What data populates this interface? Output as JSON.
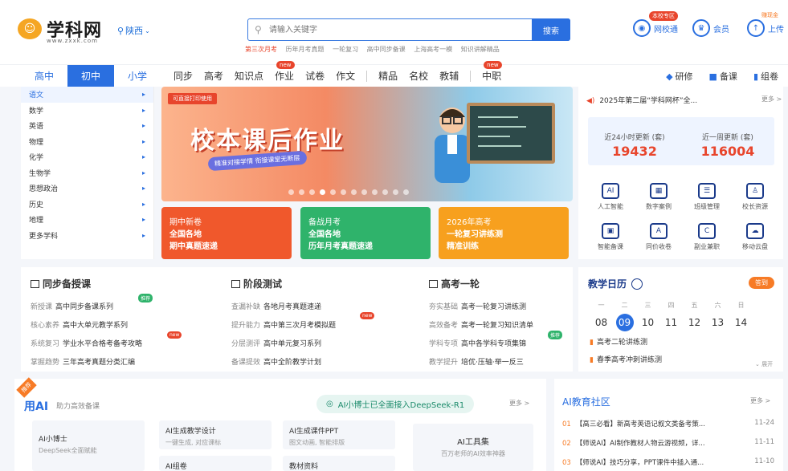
{
  "header": {
    "logo_text": "学科网",
    "logo_sub": "www.zxxk.com",
    "region": "陕西",
    "search_placeholder": "请输入关键字",
    "search_button": "搜索",
    "hotwords": [
      "第三次月考",
      "历年月考真题",
      "一轮复习",
      "高中同步备课",
      "上海高考一模",
      "知识讲解精品"
    ],
    "tools": [
      {
        "label": "网校通",
        "badge": "本校专区",
        "icon": "school-icon"
      },
      {
        "label": "会员",
        "badge": "",
        "icon": "vip-icon"
      },
      {
        "label": "上传",
        "badge": "赚现金",
        "icon": "upload-icon"
      }
    ]
  },
  "nav": {
    "stages": [
      "高中",
      "初中",
      "小学"
    ],
    "items": [
      "同步",
      "高考",
      "知识点",
      "作业",
      "试卷",
      "作文"
    ],
    "items2": [
      "精品",
      "名校",
      "教辅"
    ],
    "items3": [
      "中职"
    ],
    "new_label": "new",
    "right_links": [
      {
        "icon": "mortarboard-icon",
        "label": "研修"
      },
      {
        "icon": "book-icon",
        "label": "备课"
      },
      {
        "icon": "paper-icon",
        "label": "组卷"
      }
    ]
  },
  "sidebar": {
    "items": [
      "语文",
      "数学",
      "英语",
      "物理",
      "化学",
      "生物学",
      "思想政治",
      "历史",
      "地理",
      "更多学科"
    ]
  },
  "banner": {
    "tag": "可直接打印使用",
    "title": "校本课后作业",
    "subtitle": "精准对接学情 衔接课堂无断层"
  },
  "promos": [
    {
      "l1": "期中新卷",
      "l2": "全国各地",
      "l3": "期中真题速递",
      "color": "#f0582c"
    },
    {
      "l1": "备战月考",
      "l2": "全国各地",
      "l3": "历年月考真题速递",
      "color": "#2fb36b"
    },
    {
      "l1": "2026年高考",
      "l2": "一轮复习讲练测",
      "l3": "精准训练",
      "color": "#f7a01e"
    }
  ],
  "right": {
    "notice": "2025年第二届“学科网杯”全...",
    "notice_more": "更多 >",
    "stats": [
      {
        "label": "近24小时更新 (套)",
        "value": "19432"
      },
      {
        "label": "近一周更新 (套)",
        "value": "116004"
      }
    ],
    "grid": [
      {
        "label": "人工智能",
        "icon": "ai-icon",
        "g": "AI"
      },
      {
        "label": "数字案例",
        "icon": "calendar-icon",
        "g": "▦"
      },
      {
        "label": "班级管理",
        "icon": "board-icon",
        "g": "☰"
      },
      {
        "label": "校长资源",
        "icon": "person-icon",
        "g": "♙"
      },
      {
        "label": "智能备课",
        "icon": "screen-icon",
        "g": "▣"
      },
      {
        "label": "同价收卷",
        "icon": "doc-a-icon",
        "g": "A"
      },
      {
        "label": "副业兼职",
        "icon": "doc-c-icon",
        "g": "C"
      },
      {
        "label": "移动云盘",
        "icon": "cloud-icon",
        "g": "☁"
      }
    ]
  },
  "sync": {
    "columns": [
      {
        "title": "同步备授课",
        "rows": [
          {
            "k": "新授课",
            "v": "高中同步备课系列"
          },
          {
            "k": "核心素养",
            "v": "高中大单元教学系列"
          },
          {
            "k": "系统复习",
            "v": "学业水平合格考备考攻略"
          },
          {
            "k": "掌握趋势",
            "v": "三年高考真题分类汇编"
          }
        ]
      },
      {
        "title": "阶段测试",
        "rows": [
          {
            "k": "查漏补缺",
            "v": "各地月考真题速递"
          },
          {
            "k": "提升能力",
            "v": "高中第三次月考模拟题"
          },
          {
            "k": "分层测评",
            "v": "高中单元复习系列"
          },
          {
            "k": "备课提效",
            "v": "高中全阶教学计划"
          }
        ]
      },
      {
        "title": "高考一轮",
        "rows": [
          {
            "k": "夯实基础",
            "v": "高考一轮复习讲练测"
          },
          {
            "k": "高效备考",
            "v": "高考一轮复习知识清单"
          },
          {
            "k": "学科专项",
            "v": "高中各学科专项集锦"
          },
          {
            "k": "教学提升",
            "v": "培优·压轴·举一反三"
          }
        ]
      }
    ],
    "badge_hot": "推荐",
    "badge_new": "new"
  },
  "calendar": {
    "title": "教学日历",
    "button": "答到",
    "weekdays": [
      "一",
      "二",
      "三",
      "四",
      "五",
      "六",
      "日"
    ],
    "days": [
      "08",
      "09",
      "10",
      "11",
      "12",
      "13",
      "14"
    ],
    "events": [
      "高考二轮讲练测",
      "春季高考冲刺讲练测"
    ],
    "expand": "展开"
  },
  "ai": {
    "title": "用AI",
    "subtitle": "助力高效备课",
    "ribbon": "推荐",
    "pill": "AI小博士已全面接入DeepSeek-R1",
    "more": "更多 >",
    "cards": [
      {
        "a": "AI小博士",
        "b": "DeepSeek全面赋能"
      },
      {
        "a": "AI生成教学设计",
        "b": "一键生成, 对应课标"
      },
      {
        "a": "AI生成课件PPT",
        "b": "图文动画, 智能排版"
      },
      {
        "a": "AI工具集",
        "b": "百万老师的AI效率神器"
      },
      {
        "a": "AI组卷",
        "b": ""
      },
      {
        "a": "教材资料",
        "b": ""
      }
    ]
  },
  "community": {
    "title": "AI教育社区",
    "more": "更多 >",
    "items": [
      {
        "no": "01",
        "text": "【高三必看】新高考英语记叙文类备考策...",
        "date": "11-24"
      },
      {
        "no": "02",
        "text": "【师说AI】AI制作教材人物云游视频，详...",
        "date": "11-11"
      },
      {
        "no": "03",
        "text": "【师说AI】技巧分享，PPT课件中插入通...",
        "date": "11-10"
      }
    ]
  }
}
